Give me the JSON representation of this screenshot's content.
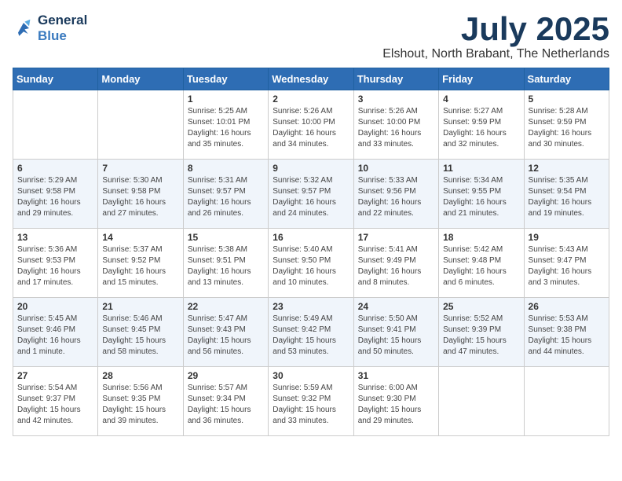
{
  "header": {
    "logo_line1": "General",
    "logo_line2": "Blue",
    "month_title": "July 2025",
    "location": "Elshout, North Brabant, The Netherlands"
  },
  "days_of_week": [
    "Sunday",
    "Monday",
    "Tuesday",
    "Wednesday",
    "Thursday",
    "Friday",
    "Saturday"
  ],
  "weeks": [
    [
      {
        "day": null
      },
      {
        "day": null
      },
      {
        "day": "1",
        "sunrise": "Sunrise: 5:25 AM",
        "sunset": "Sunset: 10:01 PM",
        "daylight": "Daylight: 16 hours and 35 minutes."
      },
      {
        "day": "2",
        "sunrise": "Sunrise: 5:26 AM",
        "sunset": "Sunset: 10:00 PM",
        "daylight": "Daylight: 16 hours and 34 minutes."
      },
      {
        "day": "3",
        "sunrise": "Sunrise: 5:26 AM",
        "sunset": "Sunset: 10:00 PM",
        "daylight": "Daylight: 16 hours and 33 minutes."
      },
      {
        "day": "4",
        "sunrise": "Sunrise: 5:27 AM",
        "sunset": "Sunset: 9:59 PM",
        "daylight": "Daylight: 16 hours and 32 minutes."
      },
      {
        "day": "5",
        "sunrise": "Sunrise: 5:28 AM",
        "sunset": "Sunset: 9:59 PM",
        "daylight": "Daylight: 16 hours and 30 minutes."
      }
    ],
    [
      {
        "day": "6",
        "sunrise": "Sunrise: 5:29 AM",
        "sunset": "Sunset: 9:58 PM",
        "daylight": "Daylight: 16 hours and 29 minutes."
      },
      {
        "day": "7",
        "sunrise": "Sunrise: 5:30 AM",
        "sunset": "Sunset: 9:58 PM",
        "daylight": "Daylight: 16 hours and 27 minutes."
      },
      {
        "day": "8",
        "sunrise": "Sunrise: 5:31 AM",
        "sunset": "Sunset: 9:57 PM",
        "daylight": "Daylight: 16 hours and 26 minutes."
      },
      {
        "day": "9",
        "sunrise": "Sunrise: 5:32 AM",
        "sunset": "Sunset: 9:57 PM",
        "daylight": "Daylight: 16 hours and 24 minutes."
      },
      {
        "day": "10",
        "sunrise": "Sunrise: 5:33 AM",
        "sunset": "Sunset: 9:56 PM",
        "daylight": "Daylight: 16 hours and 22 minutes."
      },
      {
        "day": "11",
        "sunrise": "Sunrise: 5:34 AM",
        "sunset": "Sunset: 9:55 PM",
        "daylight": "Daylight: 16 hours and 21 minutes."
      },
      {
        "day": "12",
        "sunrise": "Sunrise: 5:35 AM",
        "sunset": "Sunset: 9:54 PM",
        "daylight": "Daylight: 16 hours and 19 minutes."
      }
    ],
    [
      {
        "day": "13",
        "sunrise": "Sunrise: 5:36 AM",
        "sunset": "Sunset: 9:53 PM",
        "daylight": "Daylight: 16 hours and 17 minutes."
      },
      {
        "day": "14",
        "sunrise": "Sunrise: 5:37 AM",
        "sunset": "Sunset: 9:52 PM",
        "daylight": "Daylight: 16 hours and 15 minutes."
      },
      {
        "day": "15",
        "sunrise": "Sunrise: 5:38 AM",
        "sunset": "Sunset: 9:51 PM",
        "daylight": "Daylight: 16 hours and 13 minutes."
      },
      {
        "day": "16",
        "sunrise": "Sunrise: 5:40 AM",
        "sunset": "Sunset: 9:50 PM",
        "daylight": "Daylight: 16 hours and 10 minutes."
      },
      {
        "day": "17",
        "sunrise": "Sunrise: 5:41 AM",
        "sunset": "Sunset: 9:49 PM",
        "daylight": "Daylight: 16 hours and 8 minutes."
      },
      {
        "day": "18",
        "sunrise": "Sunrise: 5:42 AM",
        "sunset": "Sunset: 9:48 PM",
        "daylight": "Daylight: 16 hours and 6 minutes."
      },
      {
        "day": "19",
        "sunrise": "Sunrise: 5:43 AM",
        "sunset": "Sunset: 9:47 PM",
        "daylight": "Daylight: 16 hours and 3 minutes."
      }
    ],
    [
      {
        "day": "20",
        "sunrise": "Sunrise: 5:45 AM",
        "sunset": "Sunset: 9:46 PM",
        "daylight": "Daylight: 16 hours and 1 minute."
      },
      {
        "day": "21",
        "sunrise": "Sunrise: 5:46 AM",
        "sunset": "Sunset: 9:45 PM",
        "daylight": "Daylight: 15 hours and 58 minutes."
      },
      {
        "day": "22",
        "sunrise": "Sunrise: 5:47 AM",
        "sunset": "Sunset: 9:43 PM",
        "daylight": "Daylight: 15 hours and 56 minutes."
      },
      {
        "day": "23",
        "sunrise": "Sunrise: 5:49 AM",
        "sunset": "Sunset: 9:42 PM",
        "daylight": "Daylight: 15 hours and 53 minutes."
      },
      {
        "day": "24",
        "sunrise": "Sunrise: 5:50 AM",
        "sunset": "Sunset: 9:41 PM",
        "daylight": "Daylight: 15 hours and 50 minutes."
      },
      {
        "day": "25",
        "sunrise": "Sunrise: 5:52 AM",
        "sunset": "Sunset: 9:39 PM",
        "daylight": "Daylight: 15 hours and 47 minutes."
      },
      {
        "day": "26",
        "sunrise": "Sunrise: 5:53 AM",
        "sunset": "Sunset: 9:38 PM",
        "daylight": "Daylight: 15 hours and 44 minutes."
      }
    ],
    [
      {
        "day": "27",
        "sunrise": "Sunrise: 5:54 AM",
        "sunset": "Sunset: 9:37 PM",
        "daylight": "Daylight: 15 hours and 42 minutes."
      },
      {
        "day": "28",
        "sunrise": "Sunrise: 5:56 AM",
        "sunset": "Sunset: 9:35 PM",
        "daylight": "Daylight: 15 hours and 39 minutes."
      },
      {
        "day": "29",
        "sunrise": "Sunrise: 5:57 AM",
        "sunset": "Sunset: 9:34 PM",
        "daylight": "Daylight: 15 hours and 36 minutes."
      },
      {
        "day": "30",
        "sunrise": "Sunrise: 5:59 AM",
        "sunset": "Sunset: 9:32 PM",
        "daylight": "Daylight: 15 hours and 33 minutes."
      },
      {
        "day": "31",
        "sunrise": "Sunrise: 6:00 AM",
        "sunset": "Sunset: 9:30 PM",
        "daylight": "Daylight: 15 hours and 29 minutes."
      },
      {
        "day": null
      },
      {
        "day": null
      }
    ]
  ]
}
